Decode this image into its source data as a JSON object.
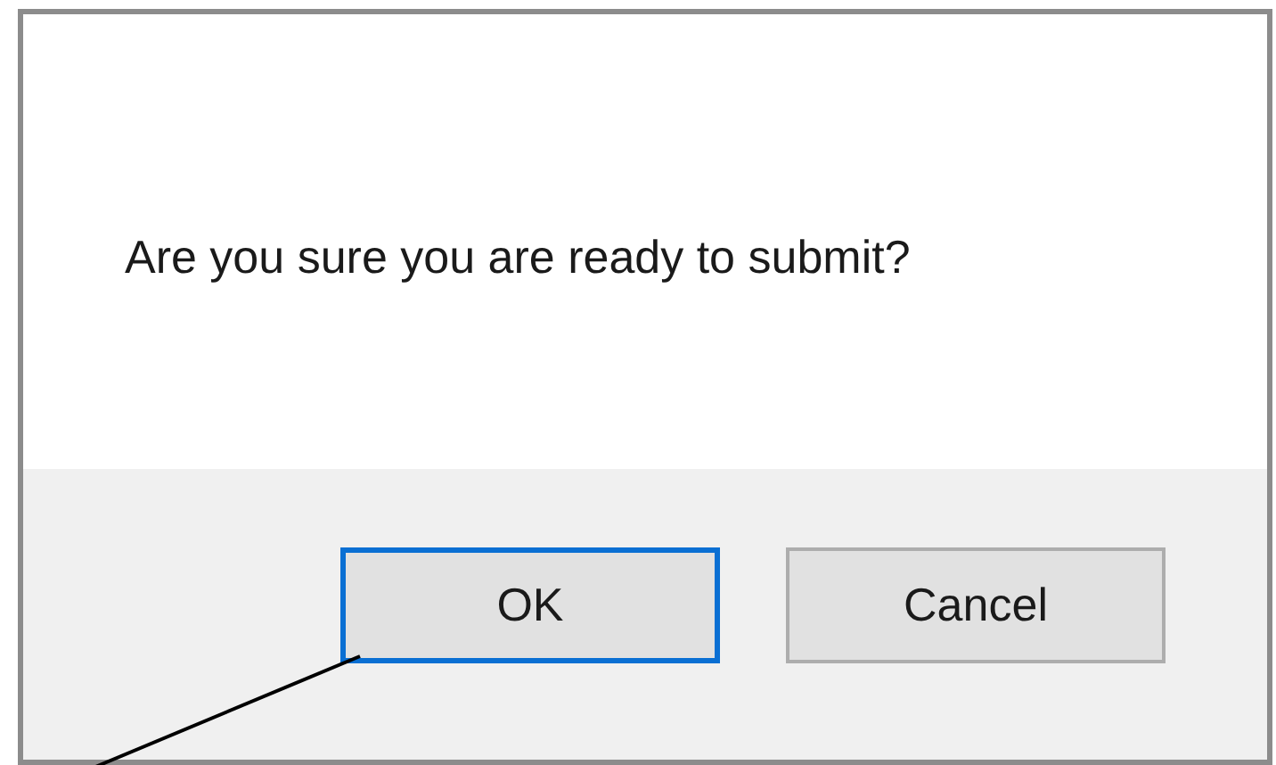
{
  "dialog": {
    "message": "Are you sure you are ready to submit?",
    "buttons": [
      {
        "label": "OK",
        "focused": true
      },
      {
        "label": "Cancel",
        "focused": false
      }
    ]
  }
}
